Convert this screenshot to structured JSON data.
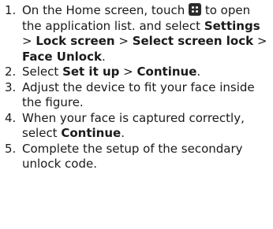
{
  "steps": [
    {
      "number": "1.",
      "t1": "On the Home screen, touch",
      "icon": "app-list-icon",
      "t2": "to open the application list. and select",
      "b1": "Settings",
      "s1": ">",
      "b2": "Lock screen",
      "s2": ">",
      "b3": "Select screen lock",
      "s3": ">",
      "b4": "Face Unlock",
      "end": "."
    },
    {
      "number": "2.",
      "t1": "Select",
      "b1": "Set it up",
      "s1": ">",
      "b2": "Continue",
      "end": "."
    },
    {
      "number": "3.",
      "text": "Adjust the device to fit your face inside the figure."
    },
    {
      "number": "4.",
      "t1": "When your face is captured correctly, select",
      "b1": "Continue",
      "end": "."
    },
    {
      "number": "5.",
      "text": "Complete the setup of the secondary unlock code."
    }
  ]
}
